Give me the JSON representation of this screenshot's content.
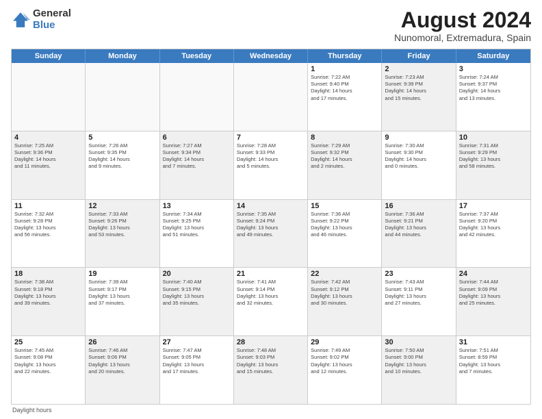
{
  "logo": {
    "general": "General",
    "blue": "Blue"
  },
  "title": "August 2024",
  "subtitle": "Nunomoral, Extremadura, Spain",
  "days_of_week": [
    "Sunday",
    "Monday",
    "Tuesday",
    "Wednesday",
    "Thursday",
    "Friday",
    "Saturday"
  ],
  "footer": "Daylight hours",
  "weeks": [
    [
      {
        "day": "",
        "info": "",
        "shaded": false,
        "empty": true
      },
      {
        "day": "",
        "info": "",
        "shaded": false,
        "empty": true
      },
      {
        "day": "",
        "info": "",
        "shaded": false,
        "empty": true
      },
      {
        "day": "",
        "info": "",
        "shaded": false,
        "empty": true
      },
      {
        "day": "1",
        "info": "Sunrise: 7:22 AM\nSunset: 9:40 PM\nDaylight: 14 hours\nand 17 minutes.",
        "shaded": false,
        "empty": false
      },
      {
        "day": "2",
        "info": "Sunrise: 7:23 AM\nSunset: 9:39 PM\nDaylight: 14 hours\nand 15 minutes.",
        "shaded": true,
        "empty": false
      },
      {
        "day": "3",
        "info": "Sunrise: 7:24 AM\nSunset: 9:37 PM\nDaylight: 14 hours\nand 13 minutes.",
        "shaded": false,
        "empty": false
      }
    ],
    [
      {
        "day": "4",
        "info": "Sunrise: 7:25 AM\nSunset: 9:36 PM\nDaylight: 14 hours\nand 11 minutes.",
        "shaded": true,
        "empty": false
      },
      {
        "day": "5",
        "info": "Sunrise: 7:26 AM\nSunset: 9:35 PM\nDaylight: 14 hours\nand 9 minutes.",
        "shaded": false,
        "empty": false
      },
      {
        "day": "6",
        "info": "Sunrise: 7:27 AM\nSunset: 9:34 PM\nDaylight: 14 hours\nand 7 minutes.",
        "shaded": true,
        "empty": false
      },
      {
        "day": "7",
        "info": "Sunrise: 7:28 AM\nSunset: 9:33 PM\nDaylight: 14 hours\nand 5 minutes.",
        "shaded": false,
        "empty": false
      },
      {
        "day": "8",
        "info": "Sunrise: 7:29 AM\nSunset: 9:32 PM\nDaylight: 14 hours\nand 2 minutes.",
        "shaded": true,
        "empty": false
      },
      {
        "day": "9",
        "info": "Sunrise: 7:30 AM\nSunset: 9:30 PM\nDaylight: 14 hours\nand 0 minutes.",
        "shaded": false,
        "empty": false
      },
      {
        "day": "10",
        "info": "Sunrise: 7:31 AM\nSunset: 9:29 PM\nDaylight: 13 hours\nand 58 minutes.",
        "shaded": true,
        "empty": false
      }
    ],
    [
      {
        "day": "11",
        "info": "Sunrise: 7:32 AM\nSunset: 9:28 PM\nDaylight: 13 hours\nand 56 minutes.",
        "shaded": false,
        "empty": false
      },
      {
        "day": "12",
        "info": "Sunrise: 7:33 AM\nSunset: 9:26 PM\nDaylight: 13 hours\nand 53 minutes.",
        "shaded": true,
        "empty": false
      },
      {
        "day": "13",
        "info": "Sunrise: 7:34 AM\nSunset: 9:25 PM\nDaylight: 13 hours\nand 51 minutes.",
        "shaded": false,
        "empty": false
      },
      {
        "day": "14",
        "info": "Sunrise: 7:35 AM\nSunset: 9:24 PM\nDaylight: 13 hours\nand 49 minutes.",
        "shaded": true,
        "empty": false
      },
      {
        "day": "15",
        "info": "Sunrise: 7:36 AM\nSunset: 9:22 PM\nDaylight: 13 hours\nand 46 minutes.",
        "shaded": false,
        "empty": false
      },
      {
        "day": "16",
        "info": "Sunrise: 7:36 AM\nSunset: 9:21 PM\nDaylight: 13 hours\nand 44 minutes.",
        "shaded": true,
        "empty": false
      },
      {
        "day": "17",
        "info": "Sunrise: 7:37 AM\nSunset: 9:20 PM\nDaylight: 13 hours\nand 42 minutes.",
        "shaded": false,
        "empty": false
      }
    ],
    [
      {
        "day": "18",
        "info": "Sunrise: 7:38 AM\nSunset: 9:18 PM\nDaylight: 13 hours\nand 39 minutes.",
        "shaded": true,
        "empty": false
      },
      {
        "day": "19",
        "info": "Sunrise: 7:39 AM\nSunset: 9:17 PM\nDaylight: 13 hours\nand 37 minutes.",
        "shaded": false,
        "empty": false
      },
      {
        "day": "20",
        "info": "Sunrise: 7:40 AM\nSunset: 9:15 PM\nDaylight: 13 hours\nand 35 minutes.",
        "shaded": true,
        "empty": false
      },
      {
        "day": "21",
        "info": "Sunrise: 7:41 AM\nSunset: 9:14 PM\nDaylight: 13 hours\nand 32 minutes.",
        "shaded": false,
        "empty": false
      },
      {
        "day": "22",
        "info": "Sunrise: 7:42 AM\nSunset: 9:12 PM\nDaylight: 13 hours\nand 30 minutes.",
        "shaded": true,
        "empty": false
      },
      {
        "day": "23",
        "info": "Sunrise: 7:43 AM\nSunset: 9:11 PM\nDaylight: 13 hours\nand 27 minutes.",
        "shaded": false,
        "empty": false
      },
      {
        "day": "24",
        "info": "Sunrise: 7:44 AM\nSunset: 9:09 PM\nDaylight: 13 hours\nand 25 minutes.",
        "shaded": true,
        "empty": false
      }
    ],
    [
      {
        "day": "25",
        "info": "Sunrise: 7:45 AM\nSunset: 9:08 PM\nDaylight: 13 hours\nand 22 minutes.",
        "shaded": false,
        "empty": false
      },
      {
        "day": "26",
        "info": "Sunrise: 7:46 AM\nSunset: 9:06 PM\nDaylight: 13 hours\nand 20 minutes.",
        "shaded": true,
        "empty": false
      },
      {
        "day": "27",
        "info": "Sunrise: 7:47 AM\nSunset: 9:05 PM\nDaylight: 13 hours\nand 17 minutes.",
        "shaded": false,
        "empty": false
      },
      {
        "day": "28",
        "info": "Sunrise: 7:48 AM\nSunset: 9:03 PM\nDaylight: 13 hours\nand 15 minutes.",
        "shaded": true,
        "empty": false
      },
      {
        "day": "29",
        "info": "Sunrise: 7:49 AM\nSunset: 9:02 PM\nDaylight: 13 hours\nand 12 minutes.",
        "shaded": false,
        "empty": false
      },
      {
        "day": "30",
        "info": "Sunrise: 7:50 AM\nSunset: 9:00 PM\nDaylight: 13 hours\nand 10 minutes.",
        "shaded": true,
        "empty": false
      },
      {
        "day": "31",
        "info": "Sunrise: 7:51 AM\nSunset: 8:59 PM\nDaylight: 13 hours\nand 7 minutes.",
        "shaded": false,
        "empty": false
      }
    ]
  ]
}
